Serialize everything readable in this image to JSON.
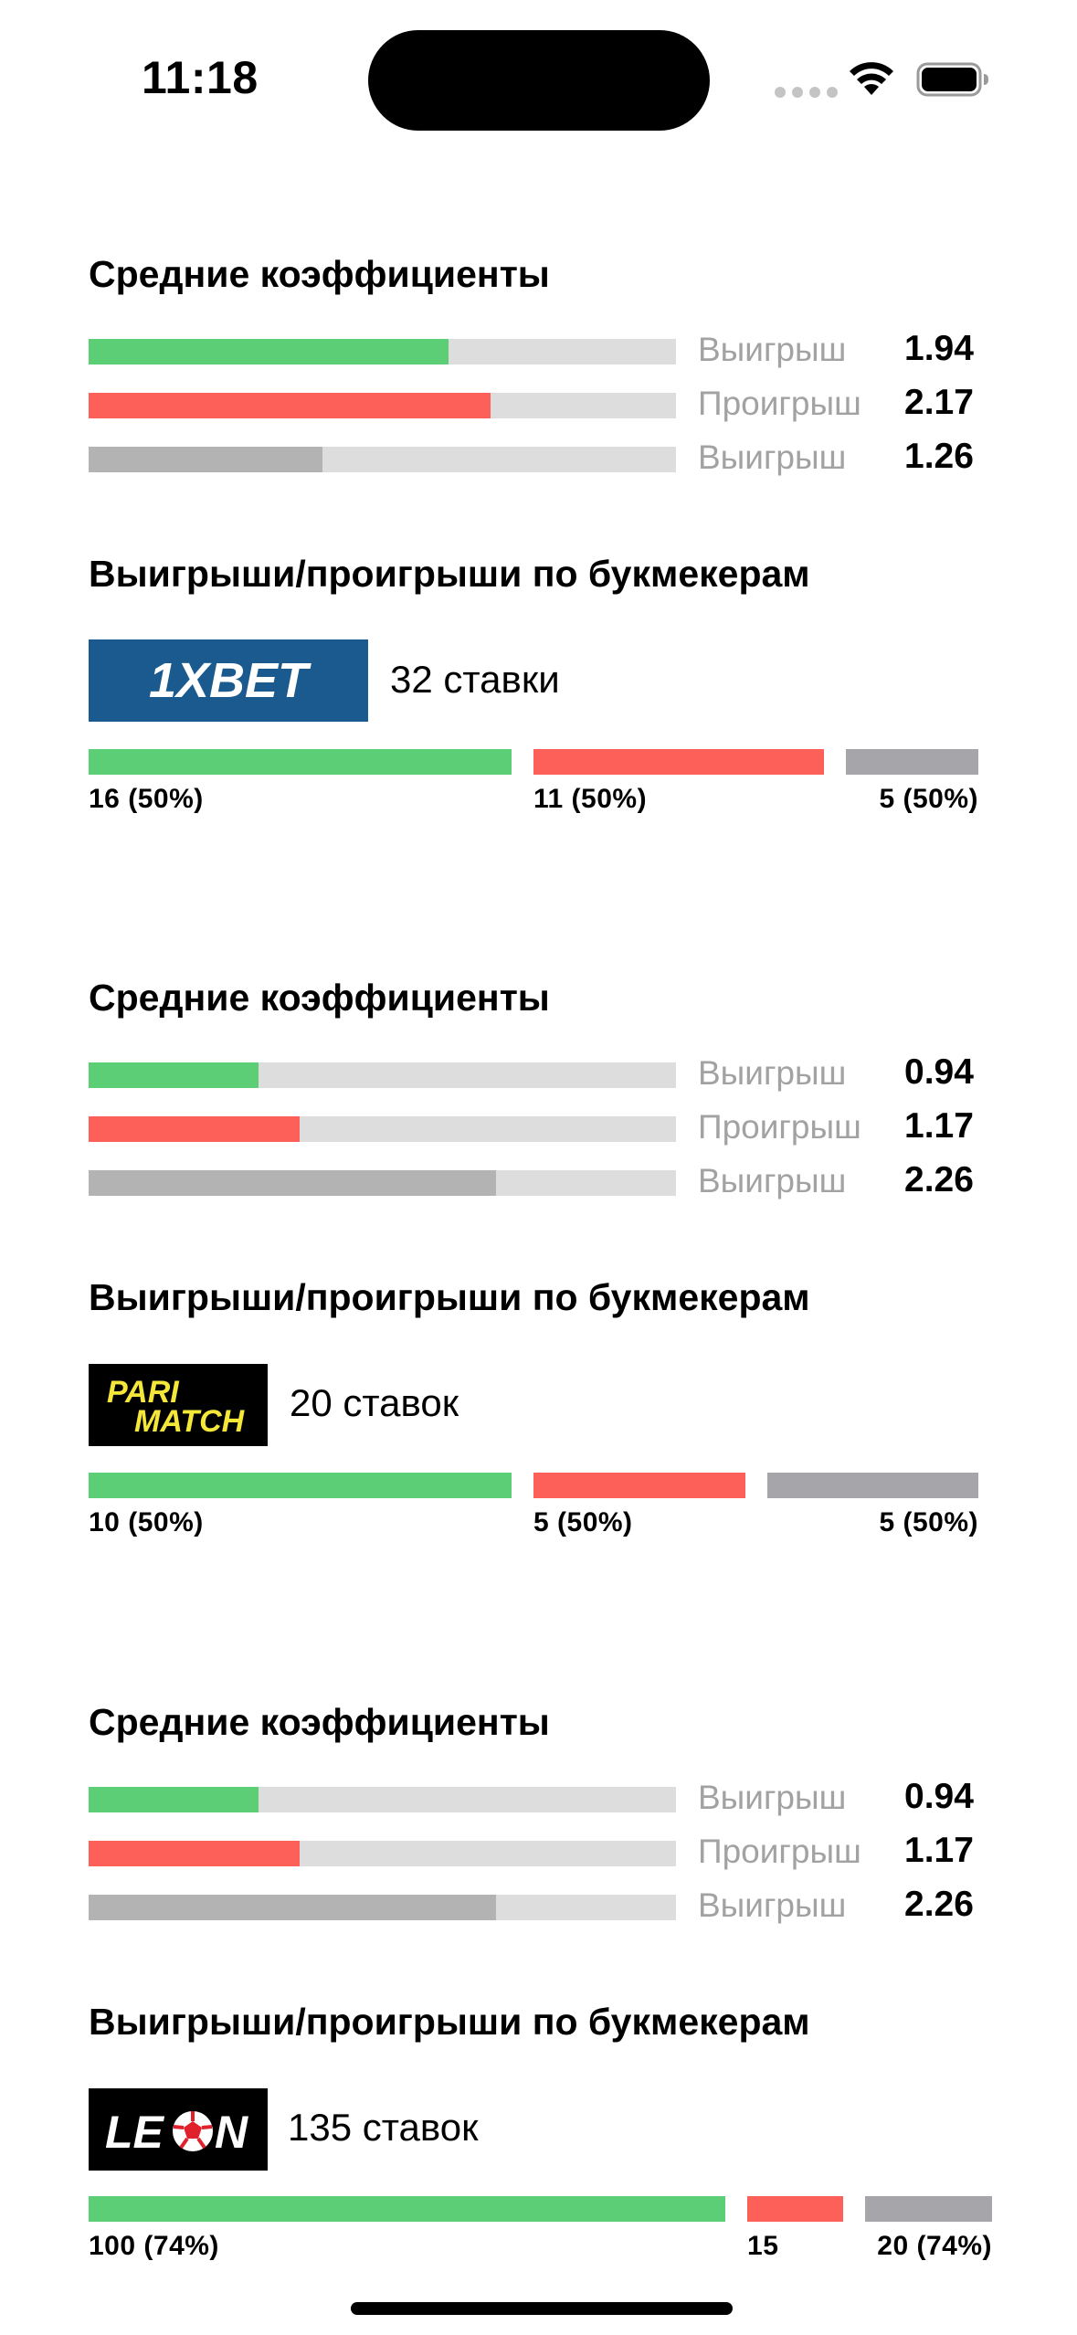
{
  "status_bar": {
    "time": "11:18"
  },
  "colors": {
    "win": "#5ccf76",
    "loss": "#fd5f59",
    "neutral_bar": "#b3b3b3",
    "segment_gray": "#a6a5aa",
    "track": "#dddddd",
    "label_gray": "#a2a2a2"
  },
  "sections": [
    {
      "odds_title": "Средние коэффициенты",
      "odds": [
        {
          "label": "Выигрыш",
          "value": "1.94",
          "fill": 0.612,
          "kind": "win"
        },
        {
          "label": "Проигрыш",
          "value": "2.17",
          "fill": 0.684,
          "kind": "loss"
        },
        {
          "label": "Выигрыш",
          "value": "1.26",
          "fill": 0.398,
          "kind": "neutral"
        }
      ],
      "bookmaker_title": "Выигрыши/проигрыши по букмекерам",
      "bookmaker": {
        "logo_icon": "1xbet-logo-icon",
        "logo_text": "1XBET",
        "count": "32 ставки",
        "segments": [
          {
            "label": "16 (50%)",
            "value": 16,
            "kind": "win"
          },
          {
            "label": "11 (50%)",
            "value": 11,
            "kind": "loss"
          },
          {
            "label": "5 (50%)",
            "value": 5,
            "kind": "gray"
          }
        ]
      }
    },
    {
      "odds_title": "Средние коэффициенты",
      "odds": [
        {
          "label": "Выигрыш",
          "value": "0.94",
          "fill": 0.289,
          "kind": "win"
        },
        {
          "label": "Проигрыш",
          "value": "1.17",
          "fill": 0.359,
          "kind": "loss"
        },
        {
          "label": "Выигрыш",
          "value": "2.26",
          "fill": 0.693,
          "kind": "neutral"
        }
      ],
      "bookmaker_title": "Выигрыши/проигрыши по букмекерам",
      "bookmaker": {
        "logo_icon": "parimatch-logo-icon",
        "logo_text_top": "PARI",
        "logo_text_bottom": "MATCH",
        "count": "20 ставок",
        "segments": [
          {
            "label": "10 (50%)",
            "value": 10,
            "kind": "win"
          },
          {
            "label": "5 (50%)",
            "value": 5,
            "kind": "loss"
          },
          {
            "label": "5 (50%)",
            "value": 5,
            "kind": "gray"
          }
        ]
      }
    },
    {
      "odds_title": "Средние коэффициенты",
      "odds": [
        {
          "label": "Выигрыш",
          "value": "0.94",
          "fill": 0.289,
          "kind": "win"
        },
        {
          "label": "Проигрыш",
          "value": "1.17",
          "fill": 0.359,
          "kind": "loss"
        },
        {
          "label": "Выигрыш",
          "value": "2.26",
          "fill": 0.693,
          "kind": "neutral"
        }
      ],
      "bookmaker_title": "Выигрыши/проигрыши по букмекерам",
      "bookmaker": {
        "logo_icon": "leon-logo-icon",
        "logo_text_start": "LE",
        "logo_text_end": "N",
        "count": "135 ставок",
        "segments": [
          {
            "label": "100 (74%)",
            "value": 100,
            "kind": "win"
          },
          {
            "label": "15",
            "value": 15,
            "kind": "loss"
          },
          {
            "label": "20 (74%)",
            "value": 20,
            "kind": "gray"
          }
        ]
      }
    }
  ]
}
